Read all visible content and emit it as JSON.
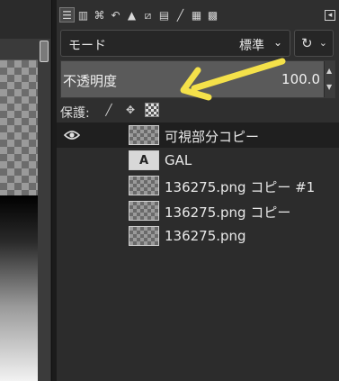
{
  "dock": {
    "tabs": [
      {
        "icon": "layers-icon",
        "glyph": "☰",
        "active": true
      },
      {
        "icon": "channels-icon",
        "glyph": "▥",
        "active": false
      },
      {
        "icon": "paths-icon",
        "glyph": "⌘",
        "active": false
      },
      {
        "icon": "undo-history-icon",
        "glyph": "↶",
        "active": false
      },
      {
        "icon": "tool-presets-icon",
        "glyph": "▲",
        "active": false
      },
      {
        "icon": "image-icon",
        "glyph": "⧄",
        "active": false
      },
      {
        "icon": "document-icon",
        "glyph": "▤",
        "active": false
      },
      {
        "icon": "brushes-icon",
        "glyph": "╱",
        "active": false
      },
      {
        "icon": "patterns-icon",
        "glyph": "▦",
        "active": false
      },
      {
        "icon": "gradients-icon",
        "glyph": "▩",
        "active": false
      }
    ],
    "config_glyph": "◂"
  },
  "mode": {
    "label": "モード",
    "value": "標準",
    "chevron": "⌄",
    "reset_glyph": "↻",
    "reset_chevron": "⌄"
  },
  "opacity": {
    "label": "不透明度",
    "value": "100.0",
    "spin_up": "▲",
    "spin_down": "▼"
  },
  "protect": {
    "label": "保護:",
    "icons": [
      {
        "name": "lock-pixels-icon",
        "glyph": "╱"
      },
      {
        "name": "lock-position-icon",
        "glyph": "✥"
      },
      {
        "name": "lock-alpha-icon",
        "glyph": ""
      }
    ]
  },
  "layers": [
    {
      "name": "可視部分コピー",
      "visible": true,
      "selected": true,
      "thumb": "checker"
    },
    {
      "name": "GAL",
      "visible": false,
      "selected": false,
      "thumb": "text",
      "thumb_glyph": "A"
    },
    {
      "name": "136275.png コピー #1",
      "visible": false,
      "selected": false,
      "thumb": "checker"
    },
    {
      "name": "136275.png コピー",
      "visible": false,
      "selected": false,
      "thumb": "checker"
    },
    {
      "name": "136275.png",
      "visible": false,
      "selected": false,
      "thumb": "checker"
    }
  ],
  "colors": {
    "annotation_arrow": "#f4e14a",
    "panel_bg": "#2f2f2f",
    "selected_row": "#1f1f1f",
    "opacity_bg": "#5a5a5a"
  }
}
